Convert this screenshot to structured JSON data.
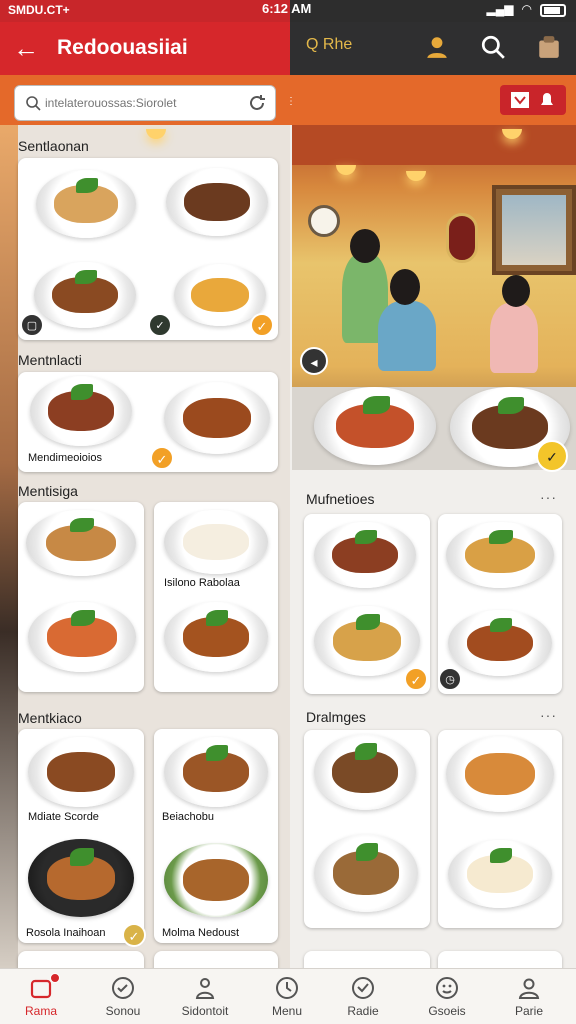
{
  "status": {
    "time_left": "SMDU.CT+",
    "time_right": "6:12 AM"
  },
  "header": {
    "title": "Redoouasiiai",
    "filter_label": "Q Rhe"
  },
  "search": {
    "placeholder": "intelaterouossas:Siorolet"
  },
  "sections": {
    "s1_title": "Sentlaonan",
    "s2_title": "Mentnlacti",
    "s2_card_label": "Mendimeoioios",
    "s3_title": "Mentisiga",
    "s3_label": "Isilono Rabolaa",
    "s4_title": "Mentkiaco",
    "s4_labels": [
      "Mdiate Scorde",
      "Beiachobu",
      "Rosola Inaihoan",
      "Molma Nedoust"
    ],
    "r1_title": "Mufnetioes",
    "r2_title": "Dralmges"
  },
  "nav": {
    "items": [
      {
        "label": "Rama",
        "icon": "home-icon"
      },
      {
        "label": "Sonou",
        "icon": "check-circle-icon"
      },
      {
        "label": "Sidontoit",
        "icon": "person-icon"
      },
      {
        "label": "Menu",
        "icon": "clock-icon"
      },
      {
        "label": "Radie",
        "icon": "shield-check-icon"
      },
      {
        "label": "Gsoeis",
        "icon": "smiley-icon"
      },
      {
        "label": "Parie",
        "icon": "profile-icon"
      }
    ]
  },
  "colors": {
    "brand_red": "#d6272b",
    "accent_orange": "#e4692a",
    "dark_bar": "#2f2f30",
    "badge_orange": "#f2a026"
  }
}
